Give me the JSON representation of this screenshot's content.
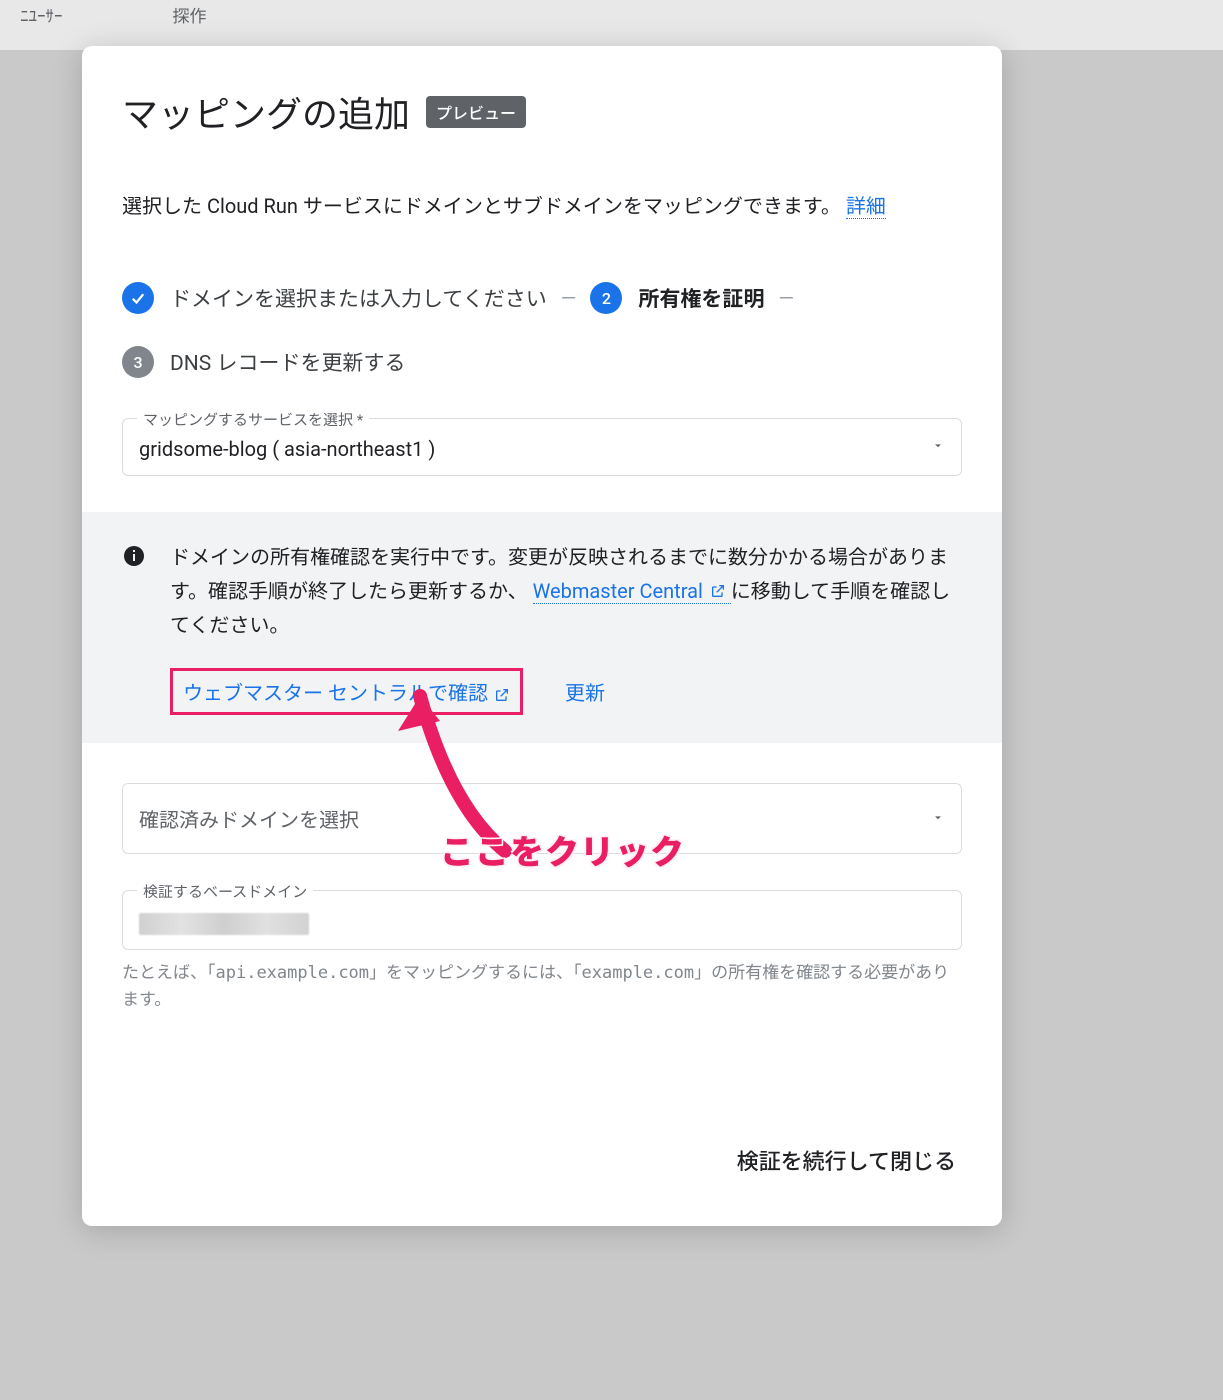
{
  "background": {
    "col1": "ﾆﾕｰｻｰ",
    "col2": "探作"
  },
  "dialog": {
    "title": "マッピングの追加",
    "preview_chip": "プレビュー",
    "description_prefix": "選択した Cloud Run サービスにドメインとサブドメインをマッピングできます。 ",
    "description_link": "詳細",
    "stepper": {
      "step1_label": "ドメインを選択または入力してください",
      "step2_num": "2",
      "step2_label": "所有権を証明",
      "step3_num": "3",
      "step3_label": "DNS レコードを更新する"
    },
    "service_select": {
      "label": "マッピングするサービスを選択 *",
      "value": "gridsome-blog ( asia-northeast1 )"
    },
    "info": {
      "text_before_link": "ドメインの所有権確認を実行中です。変更が反映されるまでに数分かかる場合があります。確認手順が終了したら更新するか、",
      "link_text": "Webmaster Central",
      "text_after_link": " に移動して手順を確認してください。",
      "confirm_button": "ウェブマスター セントラルで確認",
      "refresh_button": "更新"
    },
    "verified_select": {
      "placeholder": "確認済みドメインを選択"
    },
    "base_domain": {
      "label": "検証するベースドメイン"
    },
    "helper_text": "たとえば、「api.example.com」をマッピングするには、「example.com」の所有権を確認する必要があります。",
    "footer_button": "検証を続行して閉じる"
  },
  "annotation": {
    "label": "ここをクリック"
  }
}
